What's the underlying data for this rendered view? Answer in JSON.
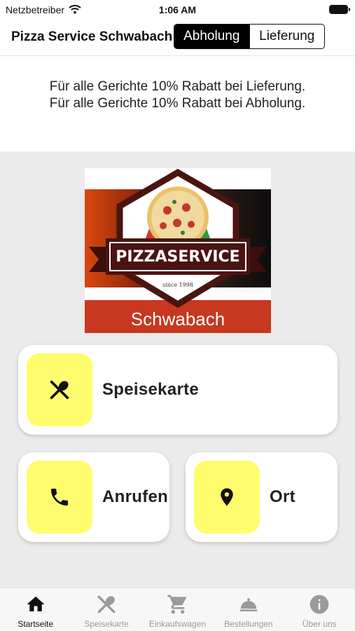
{
  "status_bar": {
    "carrier": "Netzbetreiber",
    "time": "1:06 AM"
  },
  "header": {
    "title": "Pizza Service Schwabach",
    "segments": [
      {
        "label": "Abholung",
        "selected": true
      },
      {
        "label": "Lieferung",
        "selected": false
      }
    ]
  },
  "discount": {
    "line1": "Für alle Gerichte 10% Rabatt bei Lieferung.",
    "line2": "Für alle Gerichte 10% Rabatt bei Abholung."
  },
  "logo": {
    "brand": "PIZZASERVICE",
    "since": "since 1998",
    "city": "Schwabach"
  },
  "cards": {
    "menu": {
      "label": "Speisekarte",
      "icon": "fork-spoon-icon"
    },
    "call": {
      "label": "Anrufen",
      "icon": "phone-icon"
    },
    "location": {
      "label": "Ort",
      "icon": "location-pin-icon"
    }
  },
  "colors": {
    "tile": "#fffd6e",
    "active_tab": "#111111",
    "inactive_tab": "#9a9a9a"
  },
  "tabs": [
    {
      "label": "Startseite",
      "icon": "home-icon",
      "active": true
    },
    {
      "label": "Speisekarte",
      "icon": "fork-spoon-icon",
      "active": false
    },
    {
      "label": "Einkaufswagen",
      "icon": "cart-icon",
      "active": false
    },
    {
      "label": "Bestellungen",
      "icon": "cloche-icon",
      "active": false
    },
    {
      "label": "Über uns",
      "icon": "info-icon",
      "active": false
    }
  ]
}
